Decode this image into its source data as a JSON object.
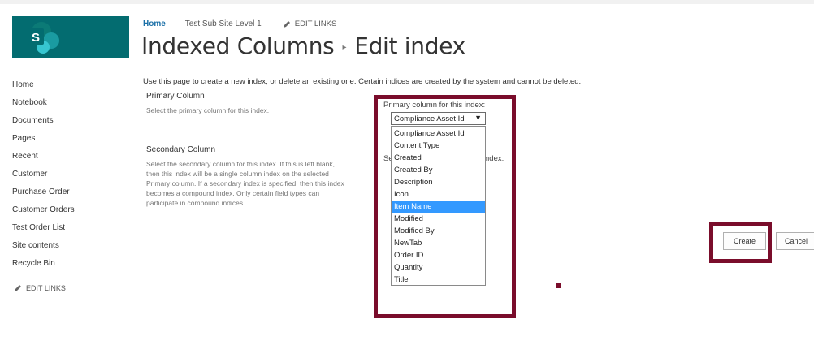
{
  "header": {
    "breadcrumb_home": "Home",
    "breadcrumb_subsite": "Test Sub Site Level 1",
    "edit_links": "EDIT LINKS"
  },
  "title": {
    "part1": "Indexed Columns",
    "separator": "▸",
    "part2": "Edit index"
  },
  "sidebar": {
    "items": [
      {
        "label": "Home"
      },
      {
        "label": "Notebook"
      },
      {
        "label": "Documents"
      },
      {
        "label": "Pages"
      },
      {
        "label": "Recent"
      },
      {
        "label": "Customer"
      },
      {
        "label": "Purchase Order"
      },
      {
        "label": "Customer Orders"
      },
      {
        "label": "Test Order List"
      },
      {
        "label": "Site contents"
      },
      {
        "label": "Recycle Bin"
      }
    ],
    "edit_links": "EDIT LINKS"
  },
  "main": {
    "intro": "Use this page to create a new index, or delete an existing one. Certain indices are created by the system and cannot be deleted.",
    "primary": {
      "title": "Primary Column",
      "desc": "Select the primary column for this index.",
      "field_label": "Primary column for this index:"
    },
    "secondary": {
      "title": "Secondary Column",
      "desc_lines": [
        "Select the secondary column for this index. If this is left blank,",
        "then this index will be a single column index on the selected",
        "Primary column. If a secondary index is specified, then this index",
        "becomes a compound index. Only certain field types can",
        "participate in compound indices."
      ],
      "label_left_fragment": "Se",
      "label_right_fragment": "ndex:"
    },
    "select": {
      "value": "Compliance Asset Id",
      "arrow": "▼",
      "options": [
        "Compliance Asset Id",
        "Content Type",
        "Created",
        "Created By",
        "Description",
        "Icon",
        "Item Name",
        "Modified",
        "Modified By",
        "NewTab",
        "Order ID",
        "Quantity",
        "Title"
      ],
      "highlighted": "Item Name"
    },
    "buttons": {
      "create": "Create",
      "cancel": "Cancel"
    }
  },
  "colors": {
    "logo_bg": "#036c70",
    "link_blue": "#1a6fa7",
    "highlight_border": "#7a0d2b",
    "selected_option": "#3399ff"
  }
}
